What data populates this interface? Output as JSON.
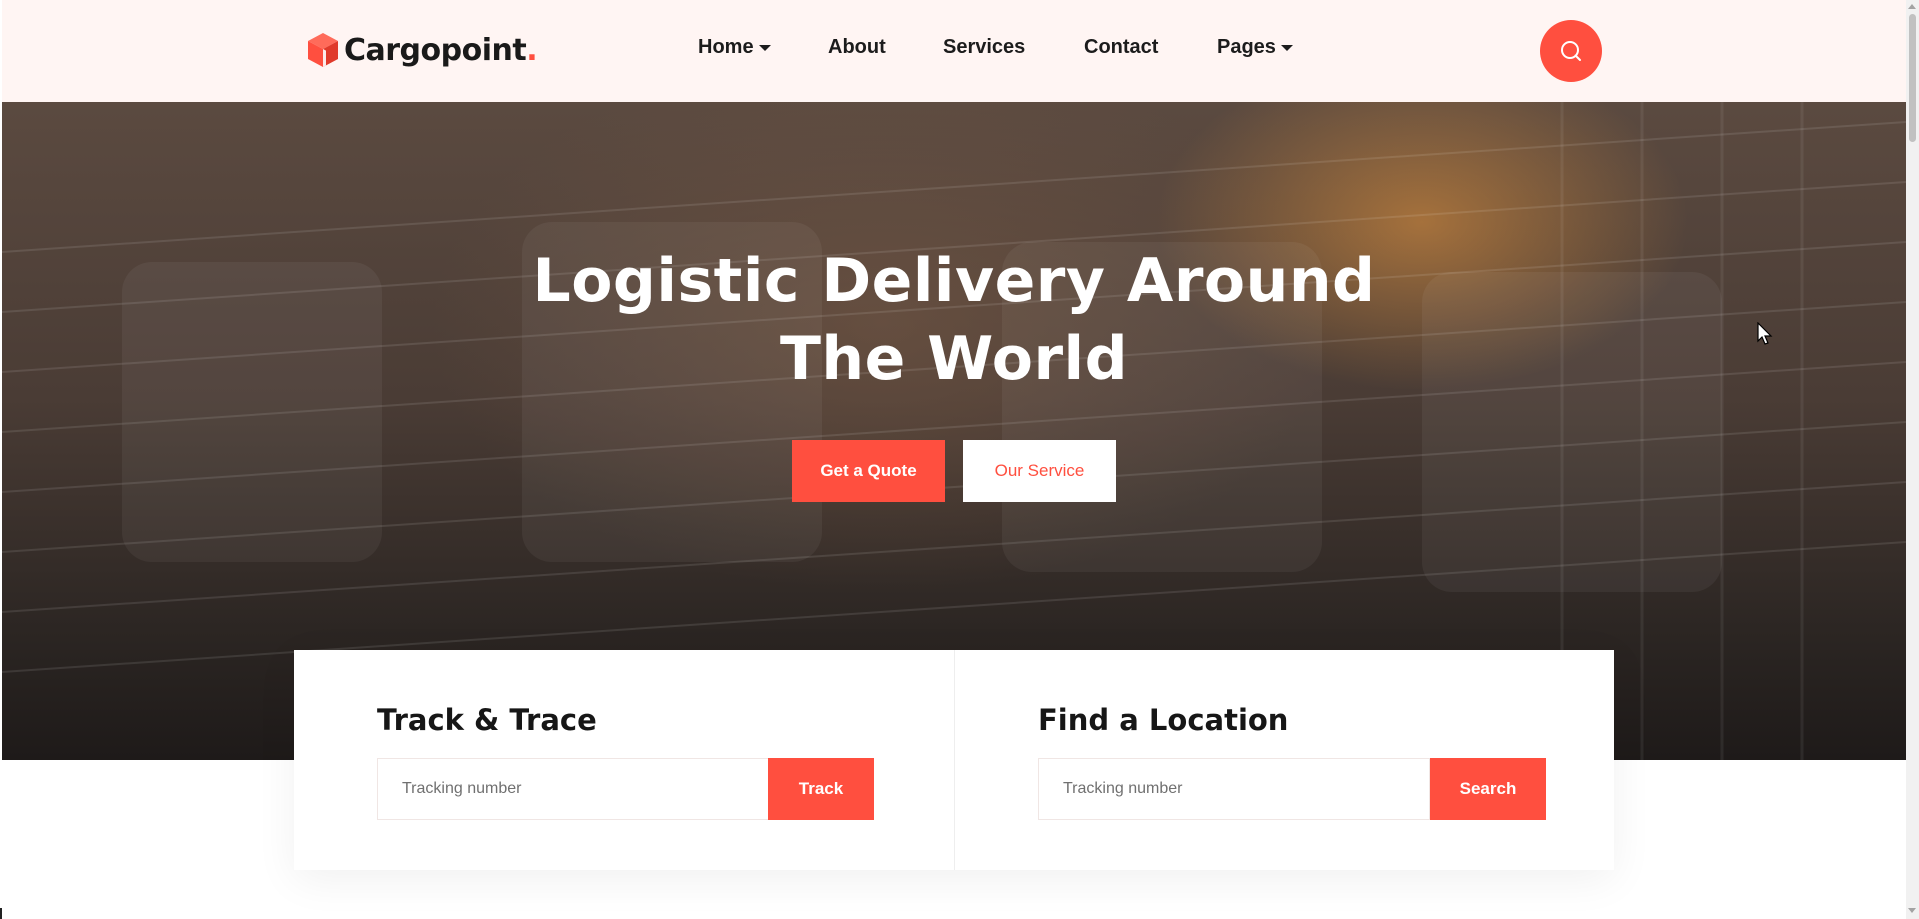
{
  "brand": {
    "name": "Cargopoint",
    "dot": ".",
    "accent_color": "#ff4f3f"
  },
  "nav": {
    "items": [
      {
        "label": "Home",
        "has_dropdown": true
      },
      {
        "label": "About",
        "has_dropdown": false
      },
      {
        "label": "Services",
        "has_dropdown": false
      },
      {
        "label": "Contact",
        "has_dropdown": false
      },
      {
        "label": "Pages",
        "has_dropdown": true
      }
    ],
    "search_icon": "search-icon"
  },
  "hero": {
    "title_line1": "Logistic Delivery Around",
    "title_line2": "The World",
    "primary_button": "Get a Quote",
    "secondary_button": "Our Service"
  },
  "track": {
    "heading": "Track & Trace",
    "placeholder": "Tracking number",
    "button": "Track"
  },
  "location": {
    "heading": "Find a Location",
    "placeholder": "Tracking number",
    "button": "Search"
  }
}
